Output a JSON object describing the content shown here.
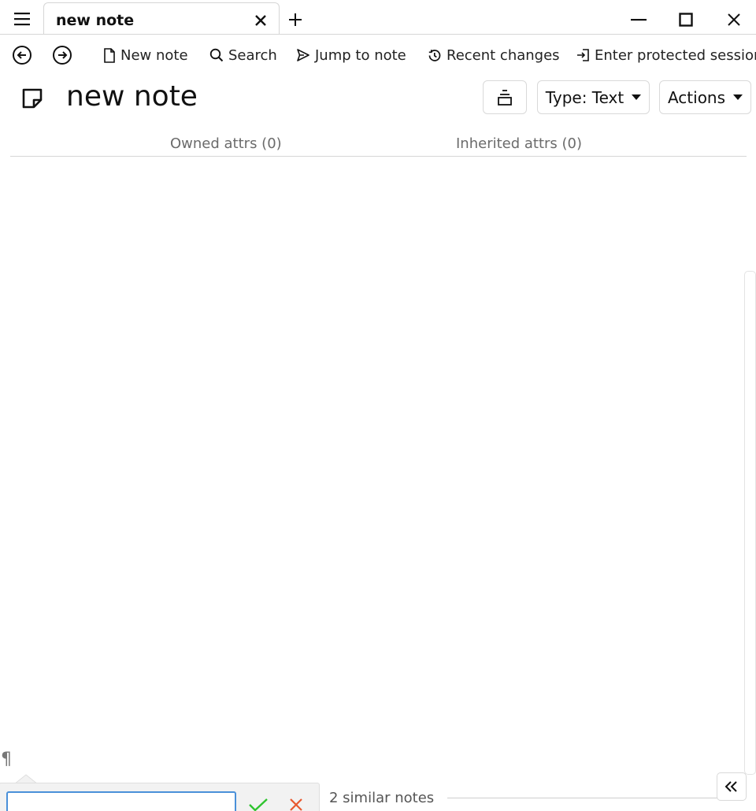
{
  "tab": {
    "title": "new note"
  },
  "toolbar": {
    "new_note": "New note",
    "search": "Search",
    "jump_to_note": "Jump to note",
    "recent_changes": "Recent changes",
    "enter_protected_session": "Enter protected session"
  },
  "note": {
    "title": "new note",
    "type_label": "Type: Text",
    "actions_label": "Actions"
  },
  "attributes": {
    "owned": "Owned attrs (0)",
    "inherited": "Inherited attrs (0)"
  },
  "editor": {
    "pilcrow": "¶",
    "input_value": "",
    "similar_notes": "2 similar notes"
  },
  "icons": {
    "menu": "hamburger-menu-icon",
    "back": "arrow-left-circle-icon",
    "forward": "arrow-right-circle-icon",
    "note": "note-icon"
  },
  "colors": {
    "confirm": "#2fc42f",
    "cancel": "#e8592f",
    "input_border": "#4a90d9"
  }
}
